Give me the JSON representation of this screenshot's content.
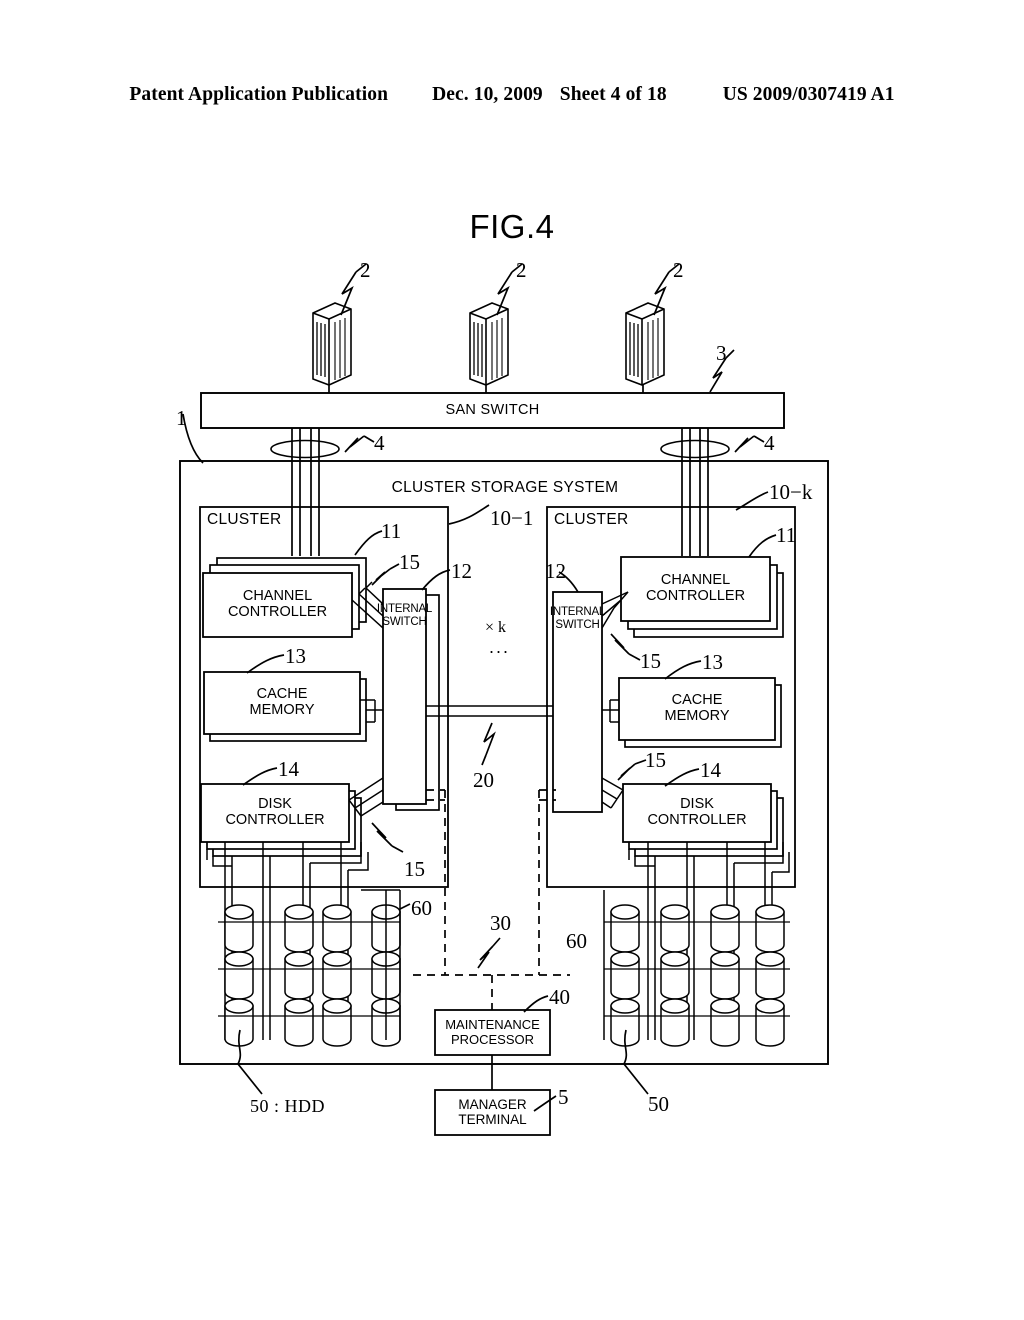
{
  "header": {
    "publication": "Patent Application Publication",
    "date": "Dec. 10, 2009",
    "sheet": "Sheet 4 of 18",
    "patent_number": "US 2009/0307419 A1"
  },
  "figure": {
    "title": "FIG.4"
  },
  "diagram": {
    "san_switch": "SAN SWITCH",
    "system_title": "CLUSTER STORAGE SYSTEM",
    "cluster_left": {
      "label": "CLUSTER",
      "channel_controller": "CHANNEL\nCONTROLLER",
      "internal_switch": "INTERNAL\nSWITCH",
      "cache_memory": "CACHE\nMEMORY",
      "disk_controller": "DISK\nCONTROLLER"
    },
    "cluster_right": {
      "label": "CLUSTER",
      "channel_controller": "CHANNEL\nCONTROLLER",
      "internal_switch": "INTERNAL\nSWITCH",
      "cache_memory": "CACHE\nMEMORY",
      "disk_controller": "DISK\nCONTROLLER"
    },
    "middle": {
      "multiplier": "× k",
      "ellipsis": "..."
    },
    "maintenance_processor": "MAINTENANCE\nPROCESSOR",
    "manager_terminal": "MANAGER\nTERMINAL",
    "hdd_legend": "50 : HDD"
  },
  "reference_numerals": {
    "host_1": "2",
    "host_2": "2",
    "host_3": "2",
    "san_switch": "3",
    "system": "1",
    "cable_left": "4",
    "cable_right": "4",
    "cluster_first": "10−1",
    "cluster_kth": "10−k",
    "channel_controller_left": "11",
    "channel_controller_right": "11",
    "internal_switch_left": "12",
    "internal_switch_right": "12",
    "cache_memory_left": "13",
    "cache_memory_right": "13",
    "disk_controller_left": "14",
    "disk_controller_right": "14",
    "path_cc_left": "15",
    "path_dc_left": "15",
    "path_cc_right": "15",
    "path_cm_right": "15",
    "path_dc_right": "15",
    "inter_cluster_bus": "20",
    "maintenance_bus": "30",
    "maintenance_processor": "40",
    "manager_terminal": "5",
    "hdd_left": "50",
    "hdd_right": "50",
    "disk_path_left": "60",
    "disk_path_right": "60"
  }
}
